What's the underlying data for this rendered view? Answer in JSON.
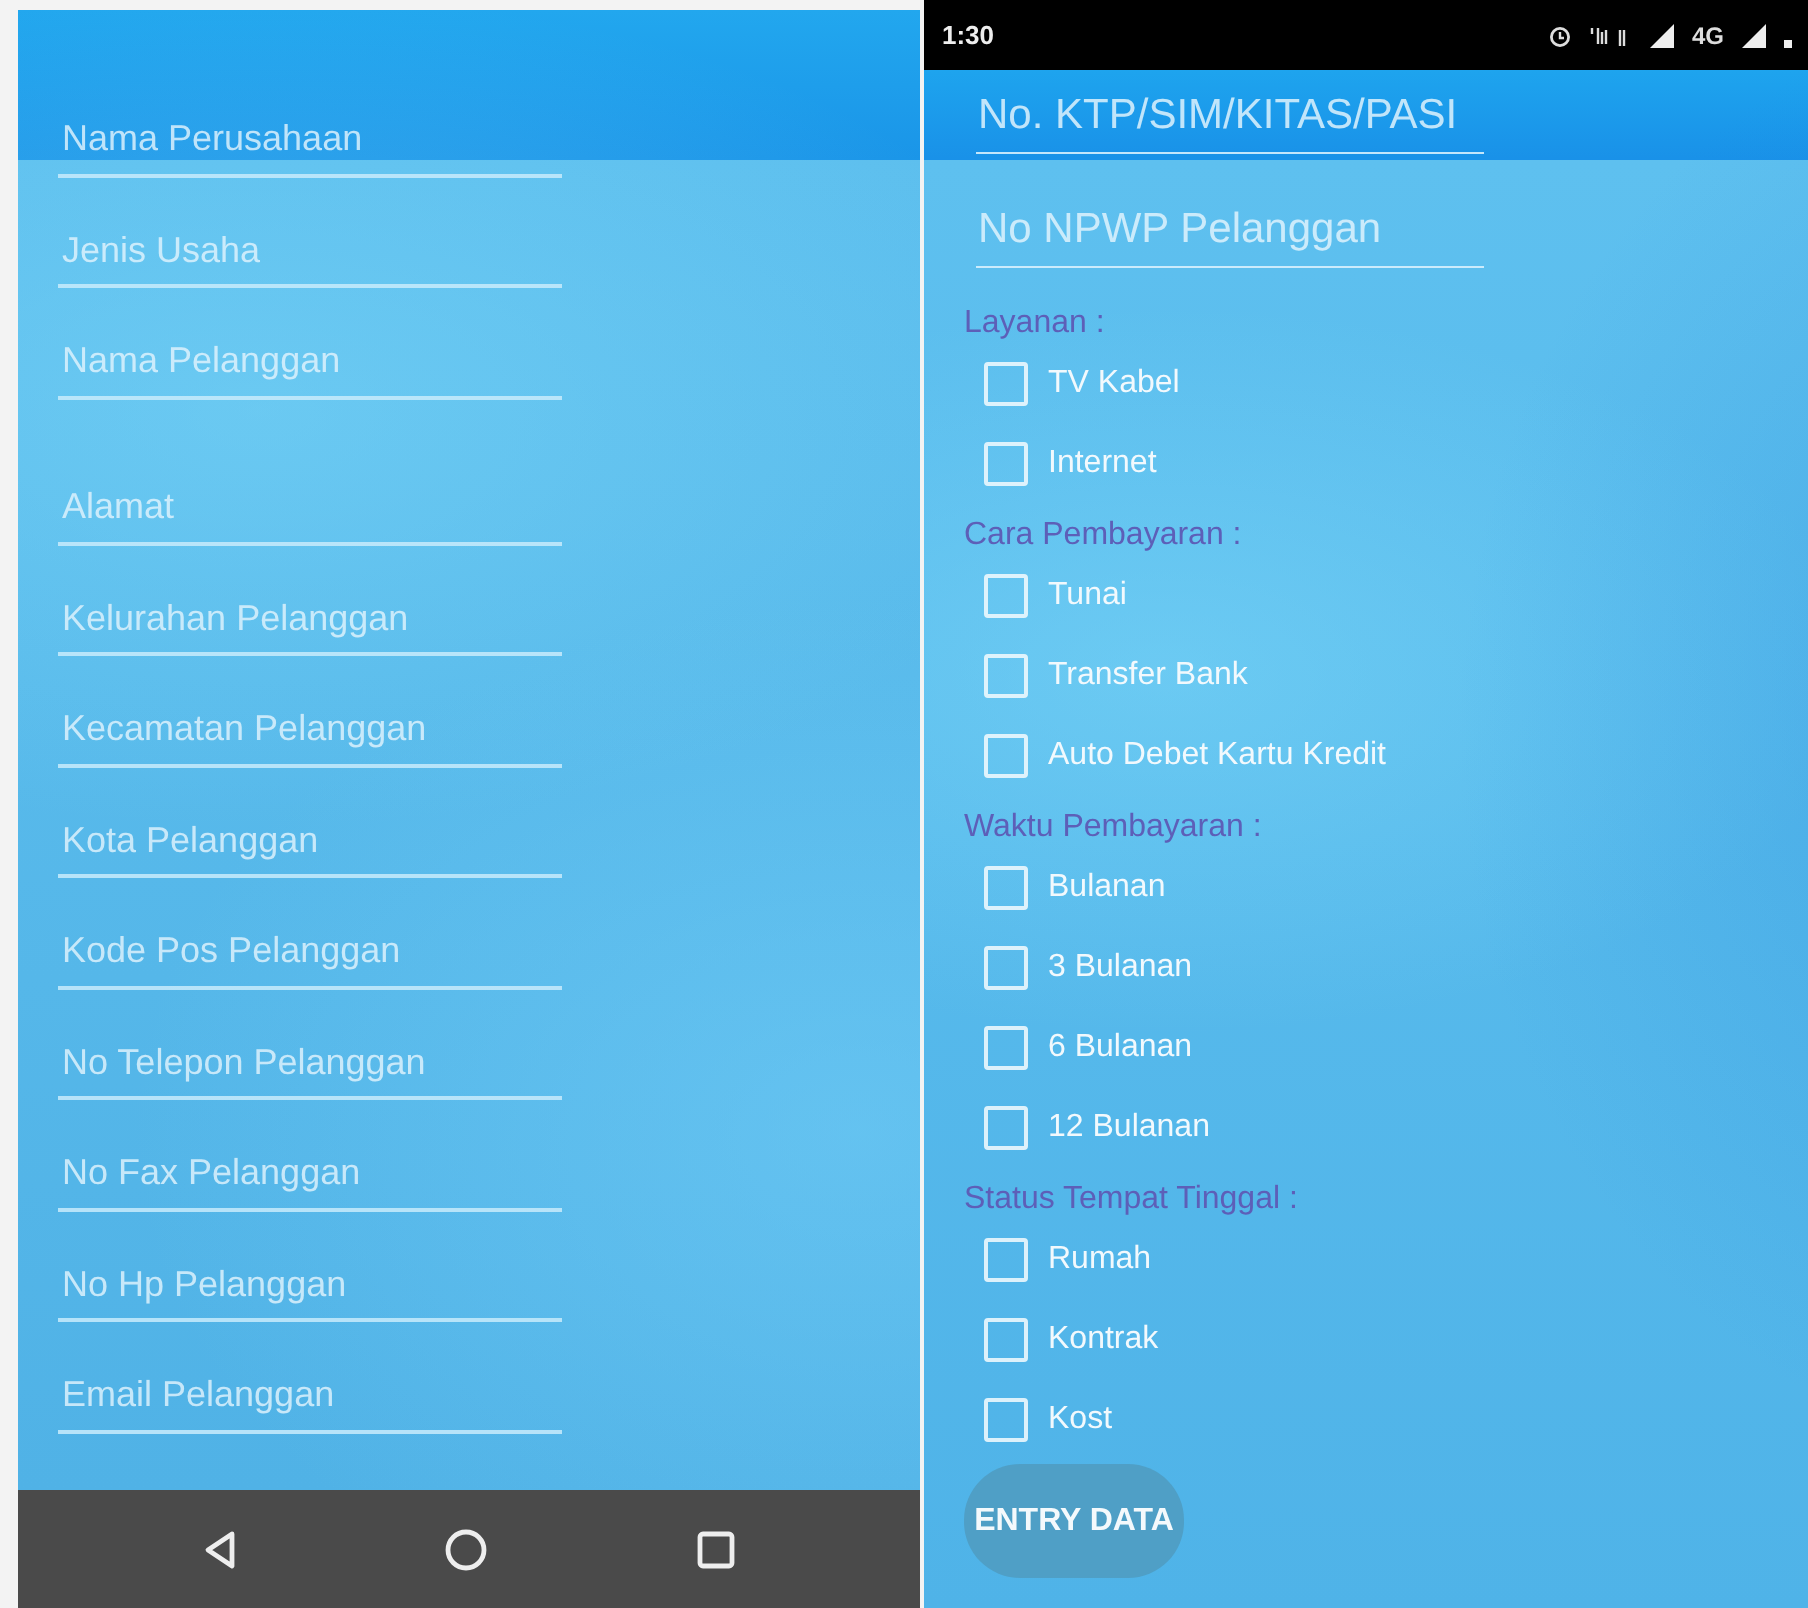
{
  "left_screen": {
    "fields": [
      {
        "placeholder": "Nama Perusahaan",
        "kind": "text"
      },
      {
        "placeholder": "Jenis Usaha",
        "kind": "text"
      },
      {
        "placeholder": "Nama Pelanggan",
        "kind": "text"
      },
      {
        "placeholder": "Alamat",
        "kind": "multiline"
      },
      {
        "placeholder": "Kelurahan Pelanggan",
        "kind": "text"
      },
      {
        "placeholder": "Kecamatan Pelanggan",
        "kind": "text"
      },
      {
        "placeholder": "Kota Pelanggan",
        "kind": "text"
      },
      {
        "placeholder": "Kode Pos Pelanggan",
        "kind": "text"
      },
      {
        "placeholder": "No Telepon Pelanggan",
        "kind": "text"
      },
      {
        "placeholder": "No Fax Pelanggan",
        "kind": "text"
      },
      {
        "placeholder": "No Hp Pelanggan",
        "kind": "text"
      },
      {
        "placeholder": "Email Pelanggan",
        "kind": "text"
      }
    ]
  },
  "right_screen": {
    "status_bar": {
      "time": "1:30",
      "network": "4G"
    },
    "fields": [
      {
        "placeholder": "No. KTP/SIM/KITAS/PASI"
      },
      {
        "placeholder": "No NPWP Pelanggan"
      }
    ],
    "sections": [
      {
        "label": "Layanan :",
        "options": [
          {
            "label": "TV Kabel",
            "checked": false
          },
          {
            "label": "Internet",
            "checked": false
          }
        ]
      },
      {
        "label": "Cara Pembayaran :",
        "options": [
          {
            "label": "Tunai",
            "checked": false
          },
          {
            "label": "Transfer Bank",
            "checked": false
          },
          {
            "label": "Auto Debet Kartu Kredit",
            "checked": false
          }
        ]
      },
      {
        "label": "Waktu Pembayaran :",
        "options": [
          {
            "label": "Bulanan",
            "checked": false
          },
          {
            "label": "3 Bulanan",
            "checked": false
          },
          {
            "label": "6 Bulanan",
            "checked": false
          },
          {
            "label": "12 Bulanan",
            "checked": false
          }
        ]
      },
      {
        "label": "Status Tempat Tinggal :",
        "options": [
          {
            "label": "Rumah",
            "checked": false
          },
          {
            "label": "Kontrak",
            "checked": false
          },
          {
            "label": "Kost",
            "checked": false
          }
        ]
      }
    ],
    "button": "ENTRY DATA"
  }
}
